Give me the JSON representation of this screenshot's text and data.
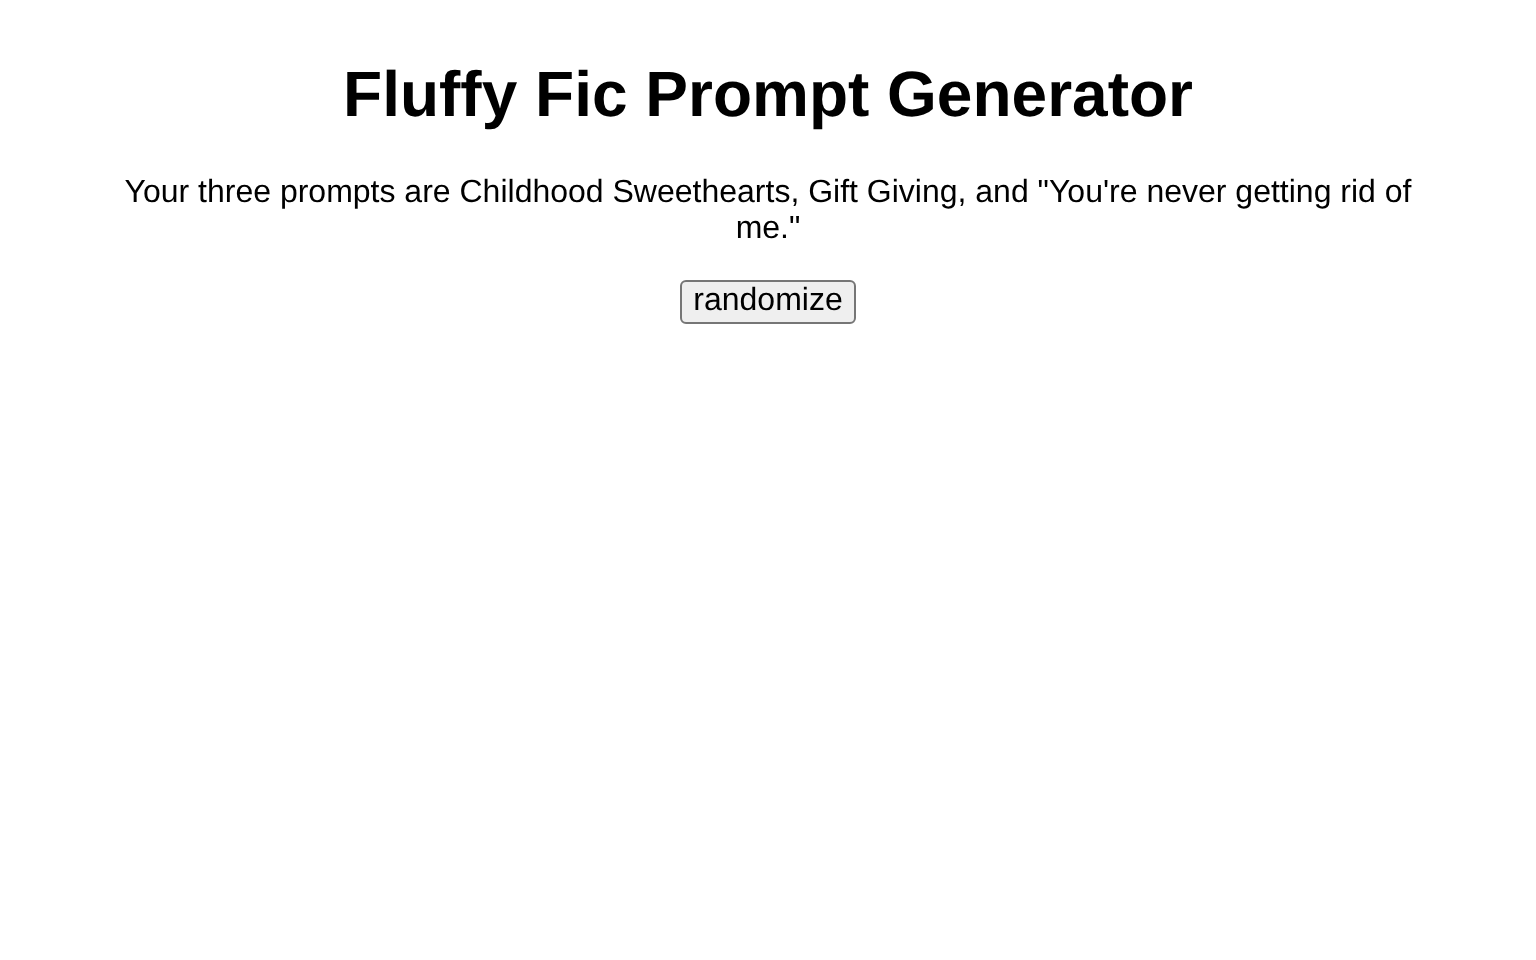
{
  "title": "Fluffy Fic Prompt Generator",
  "result_text": "Your three prompts are Childhood Sweethearts, Gift Giving, and \"You're never getting rid of me.\"",
  "button": {
    "label": "randomize"
  }
}
